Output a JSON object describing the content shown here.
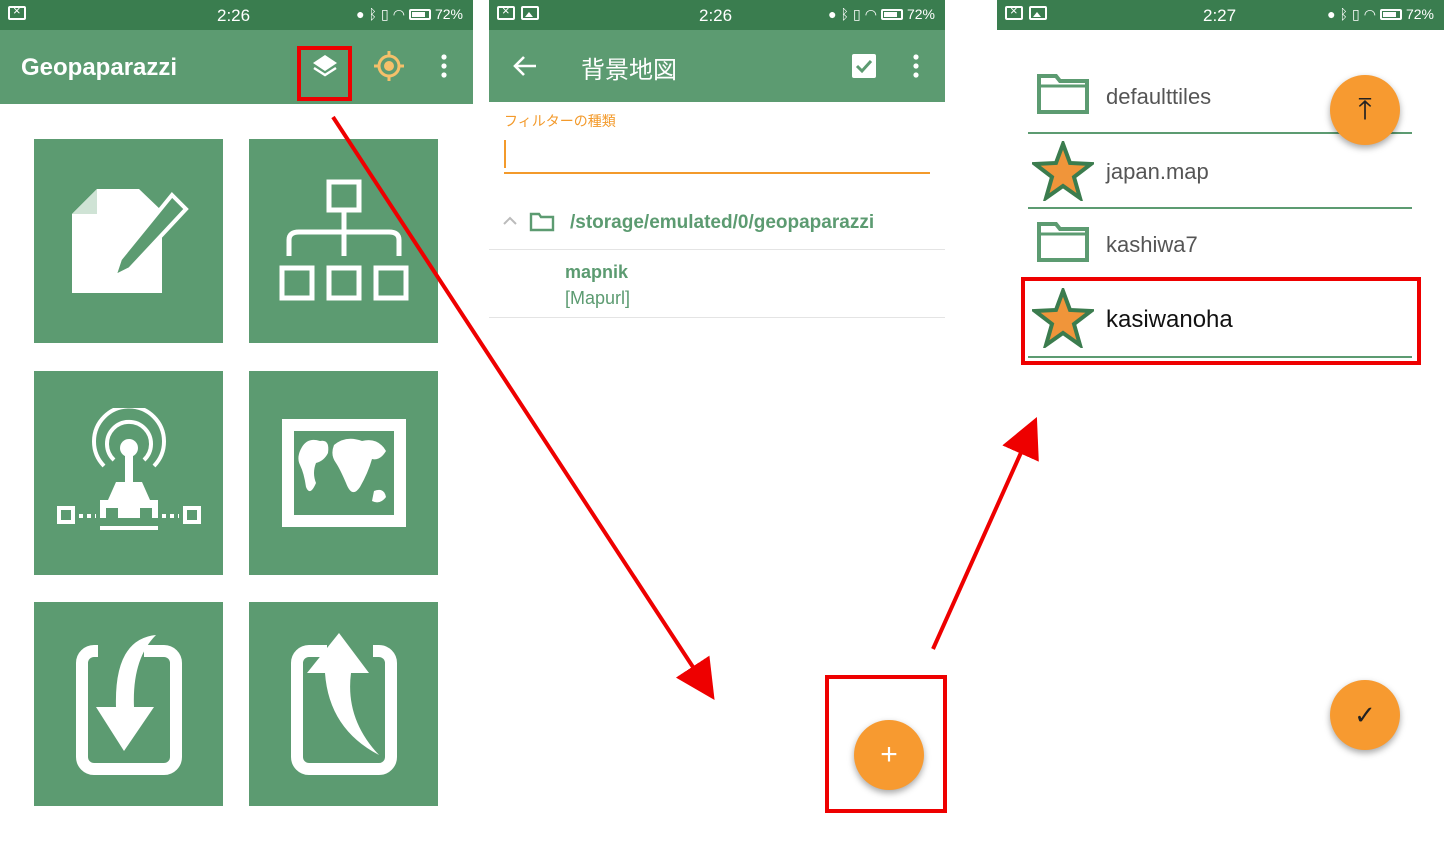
{
  "panel1": {
    "status": {
      "time": "2:26",
      "battery": "72%"
    },
    "app_title": "Geopaparazzi",
    "tiles": [
      {
        "name": "notes",
        "icon": "note-pencil-icon"
      },
      {
        "name": "metadata",
        "icon": "hierarchy-icon"
      },
      {
        "name": "gps-logging",
        "icon": "gps-antenna-icon"
      },
      {
        "name": "map-view",
        "icon": "world-map-icon"
      },
      {
        "name": "import",
        "icon": "import-arrow-icon"
      },
      {
        "name": "export",
        "icon": "export-arrow-icon"
      }
    ]
  },
  "panel2": {
    "status": {
      "time": "2:26",
      "battery": "72%"
    },
    "title": "背景地図",
    "filter_label": "フィルターの種類",
    "filter_value": "",
    "path": "/storage/emulated/0/geopaparazzi",
    "entry": {
      "name": "mapnik",
      "type": "[Mapurl]"
    },
    "fab_symbol": "+"
  },
  "panel3": {
    "status": {
      "time": "2:27",
      "battery": "72%"
    },
    "items": [
      {
        "label": "defaulttiles",
        "icon": "folder-icon"
      },
      {
        "label": "japan.map",
        "icon": "star-icon"
      },
      {
        "label": "kashiwa7",
        "icon": "folder-icon"
      },
      {
        "label": "kasiwanoha",
        "icon": "star-icon"
      }
    ],
    "fab_top_symbol": "⤒",
    "fab_confirm_symbol": "✓"
  },
  "colors": {
    "status_bar": "#3a7d4f",
    "app_bar": "#5c9b71",
    "accent": "#f79a30",
    "highlight": "#ee0000"
  }
}
